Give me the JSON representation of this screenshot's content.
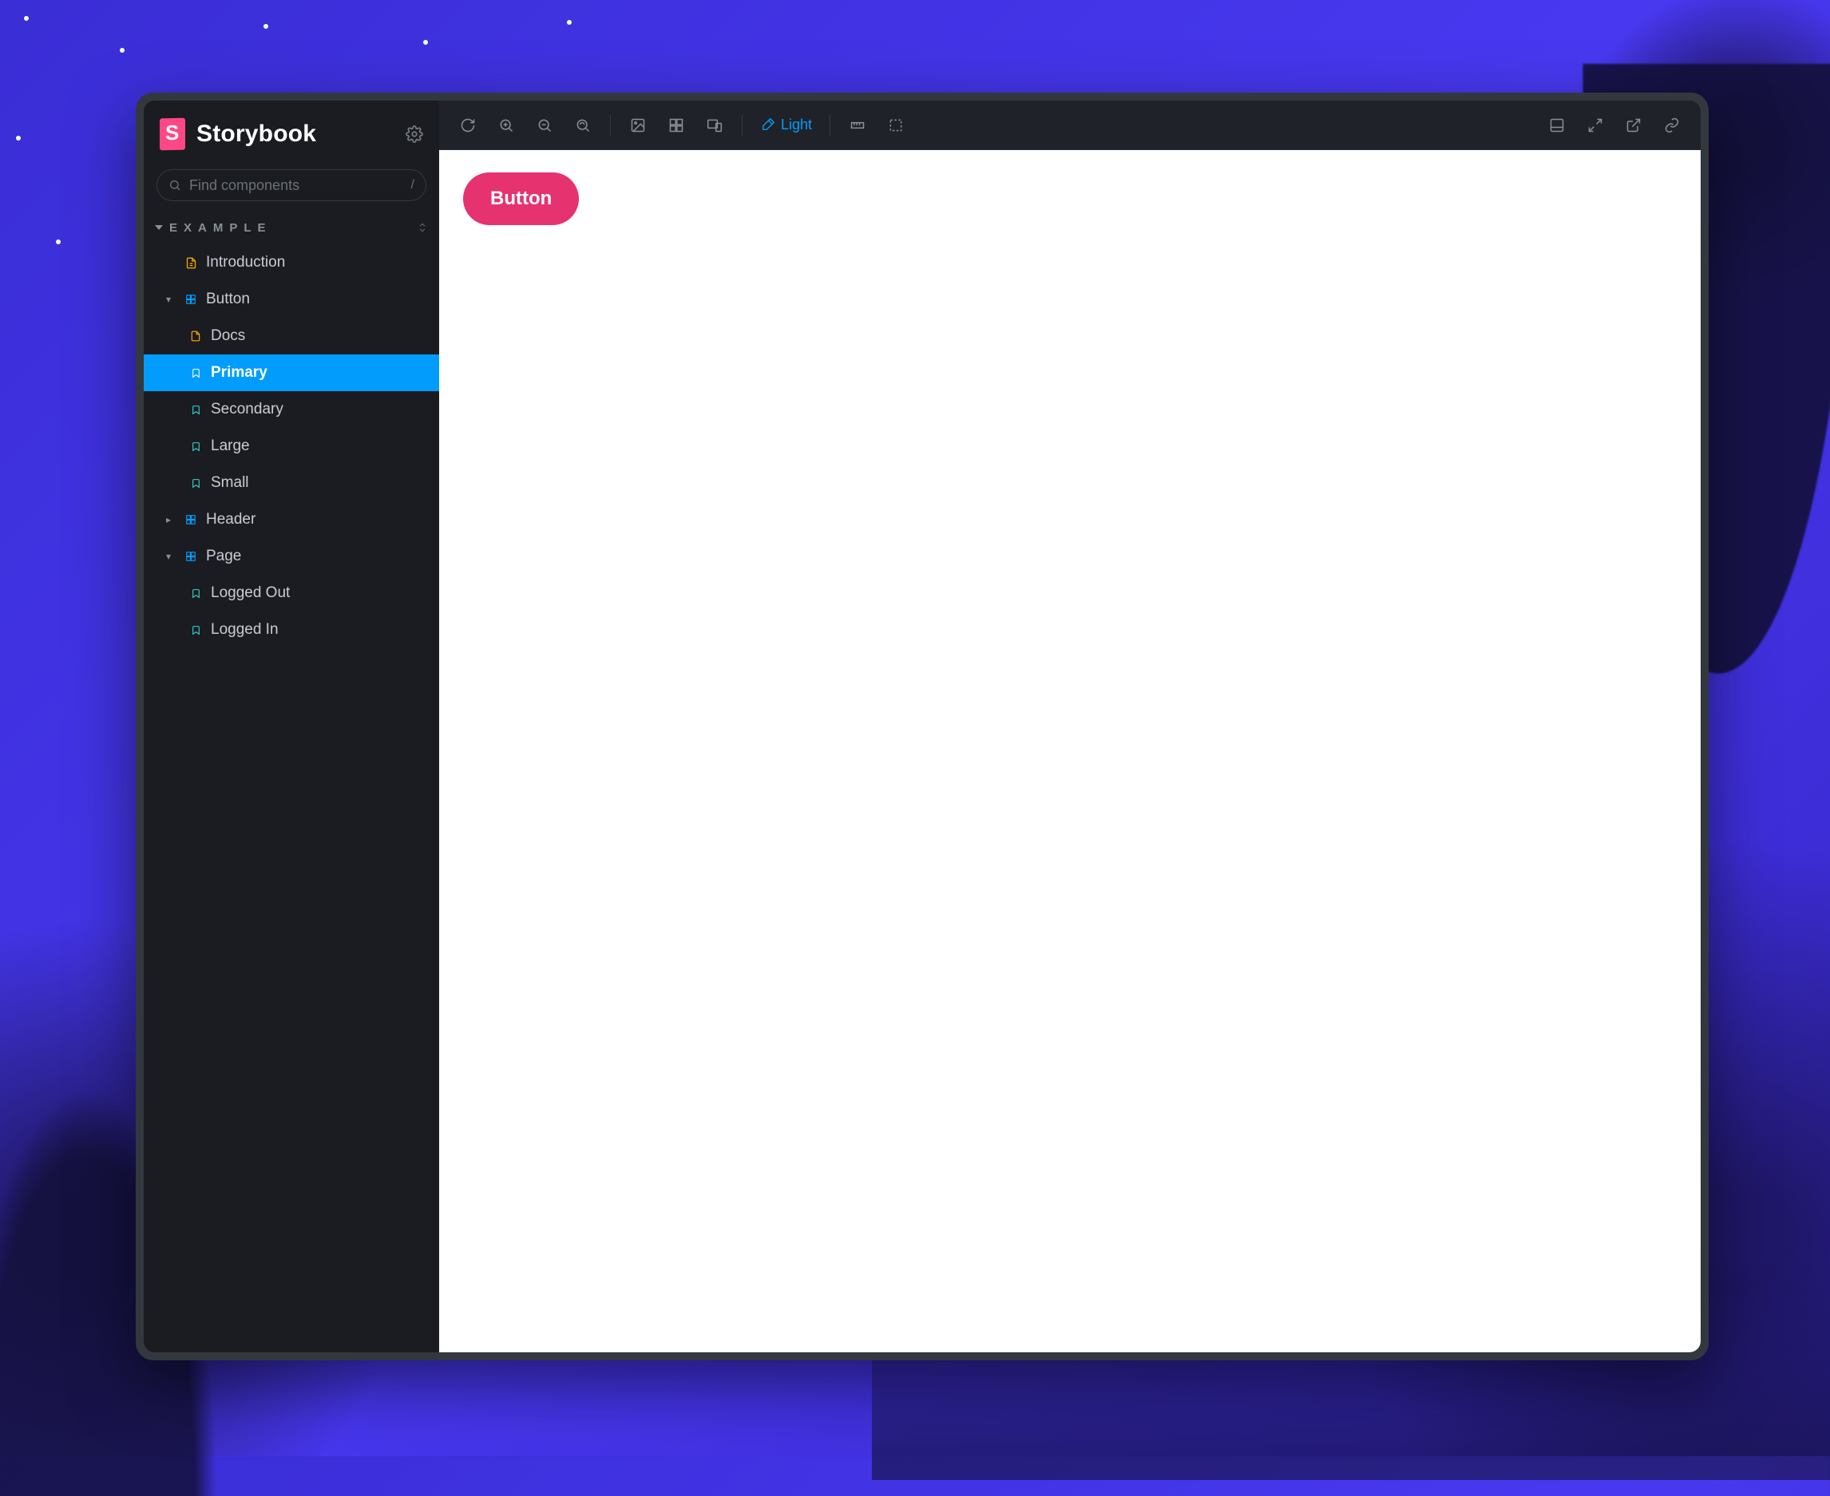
{
  "app": {
    "name": "Storybook"
  },
  "search": {
    "placeholder": "Find components",
    "shortcut": "/"
  },
  "section": {
    "label": "EXAMPLE"
  },
  "sidebar": {
    "items": [
      {
        "kind": "doc",
        "label": "Introduction",
        "depth": 1
      },
      {
        "kind": "component",
        "label": "Button",
        "depth": 1,
        "expanded": true,
        "children": [
          {
            "kind": "doc",
            "label": "Docs"
          },
          {
            "kind": "story",
            "label": "Primary",
            "active": true
          },
          {
            "kind": "story",
            "label": "Secondary"
          },
          {
            "kind": "story",
            "label": "Large"
          },
          {
            "kind": "story",
            "label": "Small"
          }
        ]
      },
      {
        "kind": "component",
        "label": "Header",
        "depth": 1,
        "expanded": false
      },
      {
        "kind": "component",
        "label": "Page",
        "depth": 1,
        "expanded": true,
        "children": [
          {
            "kind": "story",
            "label": "Logged Out"
          },
          {
            "kind": "story",
            "label": "Logged In"
          }
        ]
      }
    ]
  },
  "toolbar": {
    "theme_label": "Light"
  },
  "canvas": {
    "button_label": "Button"
  },
  "colors": {
    "accent": "#029cfd",
    "brand": "#ff4785",
    "sample_button": "#e6326e"
  }
}
